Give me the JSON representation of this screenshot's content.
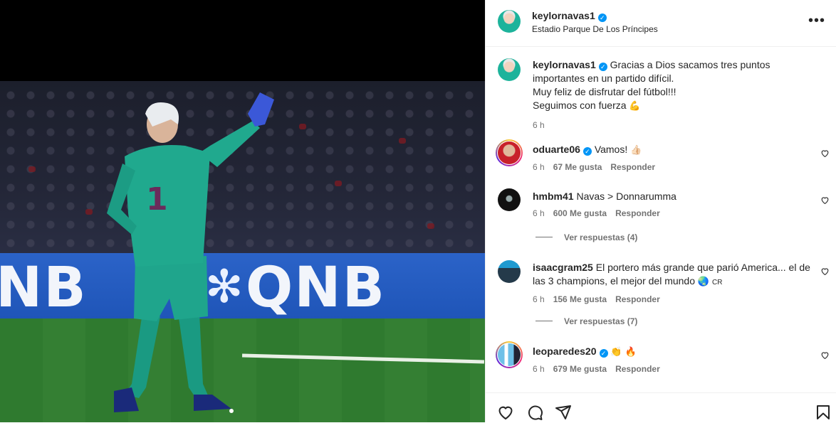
{
  "post": {
    "author": "keylornavas1",
    "location": "Estadio Parque De Los Príncipes",
    "caption_lines": [
      "Gracias a Dios sacamos tres puntos importantes en un partido difícil.",
      "Muy feliz de disfrutar del fútbol!!!",
      "Seguimos con fuerza"
    ],
    "caption_emoji": "💪",
    "time": "6 h",
    "more_label": "•••"
  },
  "photo": {
    "sponsor_text_left": "NB",
    "sponsor_text_right": "QNB",
    "jersey_number": "1"
  },
  "comments": [
    {
      "user": "oduarte06",
      "verified": true,
      "text": "Vamos!",
      "emoji": "👍🏻",
      "time": "6 h",
      "likes": "67 Me gusta",
      "reply": "Responder"
    },
    {
      "user": "hmbm41",
      "verified": false,
      "text": "Navas > Donnarumma",
      "emoji": "",
      "time": "6 h",
      "likes": "600 Me gusta",
      "reply": "Responder",
      "view_replies": "Ver respuestas (4)"
    },
    {
      "user": "isaacgram25",
      "verified": false,
      "text": "El portero más grande que parió America... el de las 3 champions, el mejor del mundo",
      "emoji": "🌏",
      "suffix": "CR",
      "time": "6 h",
      "likes": "156 Me gusta",
      "reply": "Responder",
      "view_replies": "Ver respuestas (7)"
    },
    {
      "user": "leoparedes20",
      "verified": true,
      "text": "",
      "emoji": "👏 🔥",
      "time": "6 h",
      "likes": "679 Me gusta",
      "reply": "Responder"
    }
  ],
  "icons": {
    "like": "heart-icon",
    "comment": "comment-icon",
    "share": "share-icon",
    "save": "bookmark-icon"
  },
  "colors": {
    "verified": "#0095f6",
    "meta": "#737373",
    "text": "#262626",
    "board_blue": "#2b63c8",
    "keeper_kit": "#1fa58c"
  }
}
